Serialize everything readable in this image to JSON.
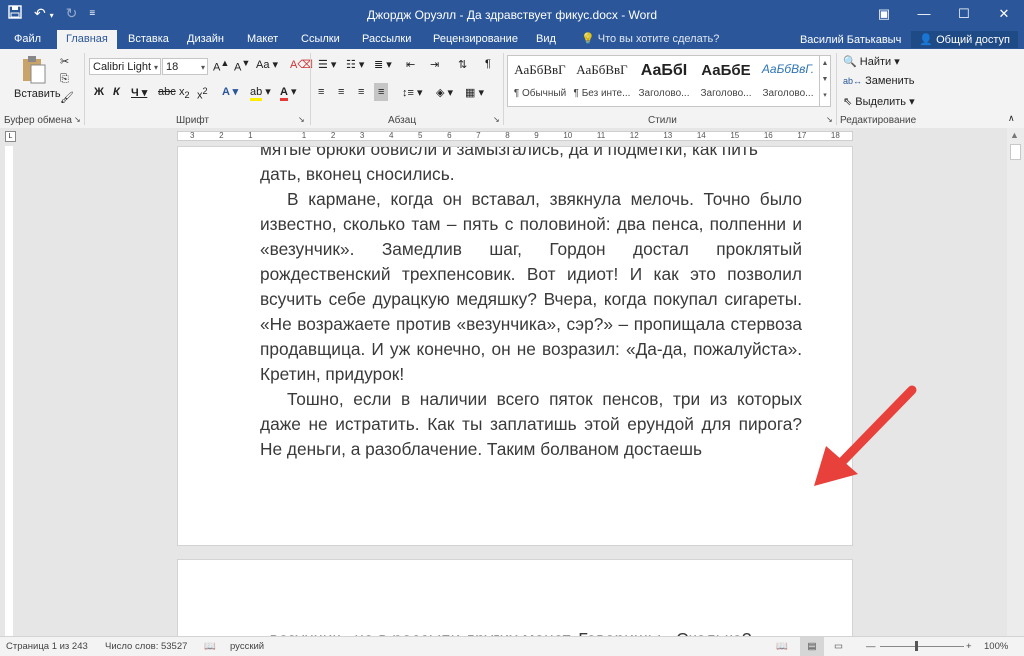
{
  "window": {
    "title": "Джордж Оруэлл - Да здравствует фикус.docx - Word"
  },
  "tabs": [
    "Файл",
    "Главная",
    "Вставка",
    "Дизайн",
    "Макет",
    "Ссылки",
    "Рассылки",
    "Рецензирование",
    "Вид"
  ],
  "tell_me": "Что вы хотите сделать?",
  "user": "Василий Батькавыч",
  "share": "Общий доступ",
  "ribbon": {
    "paste_label": "Вставить",
    "clipboard_label": "Буфер обмена",
    "font_name": "Calibri Light",
    "font_size": "18",
    "font_label": "Шрифт",
    "paragraph_label": "Абзац",
    "styles_label": "Стили",
    "editing_label": "Редактирование",
    "find_label": "Найти",
    "replace_label": "Заменить",
    "select_label": "Выделить",
    "styles": [
      {
        "sample": "АаБбВвГ",
        "name": "¶ Обычный"
      },
      {
        "sample": "АаБбВвГ",
        "name": "¶ Без инте..."
      },
      {
        "sample": "АаБбI",
        "name": "Заголово..."
      },
      {
        "sample": "АаБбЕ",
        "name": "Заголово..."
      },
      {
        "sample": "АаБбВвГ.",
        "name": "Заголово..."
      }
    ]
  },
  "ruler_numbers": [
    "3",
    "2",
    "1",
    "",
    "1",
    "2",
    "3",
    "4",
    "5",
    "6",
    "7",
    "8",
    "9",
    "10",
    "11",
    "12",
    "13",
    "14",
    "15",
    "16",
    "17",
    "18"
  ],
  "document": {
    "cut_line": "мятые брюки обвисли и замызгались, да и подметки, как пить",
    "para0_end": "дать, вконец сносились.",
    "para1": "В кармане, когда он вставал, звякнула мелочь. Точно было известно, сколько там – пять с половиной: два пенса, полпенни и «везунчик». Замедлив шаг, Гордон достал проклятый рождественский трехпенсовик. Вот идиот! И как это позволил всучить себе дурацкую медяшку? Вчера, когда покупал сигареты. «Не возражаете против «везунчика», сэр?» – пропищала стервоза продавщица. И уж конечно, он не возразил: «Да-да, пожалуйста». Кретин, придурок!",
    "para2": "Тошно, если в наличии всего пяток пенсов, три из которых даже не истратить. Как ты заплатишь этой ерундой для пирога? Не деньги, а разоблачение. Таким болваном достаешь",
    "page2_line": "«везунчик» не в россыпи других монет. Говоришь: «Сколько?»"
  },
  "status": {
    "page": "Страница 1 из 243",
    "words": "Число слов: 53527",
    "language": "русский",
    "zoom": "100%"
  }
}
